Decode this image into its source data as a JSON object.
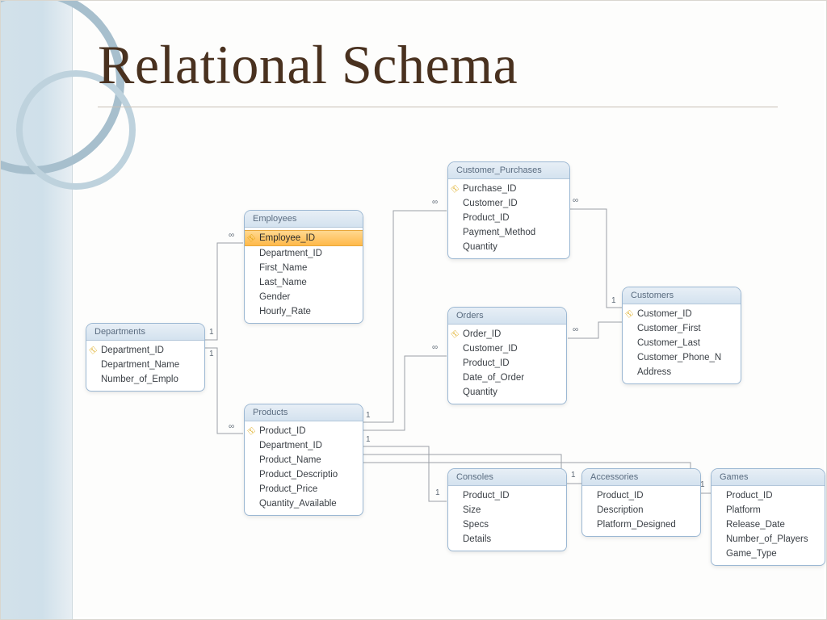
{
  "title": "Relational Schema",
  "tables": {
    "departments": {
      "name": "Departments",
      "fields": [
        {
          "label": "Department_ID",
          "pk": true
        },
        {
          "label": "Department_Name",
          "pk": false
        },
        {
          "label": "Number_of_Emplo",
          "pk": false
        }
      ]
    },
    "employees": {
      "name": "Employees",
      "fields": [
        {
          "label": "Employee_ID",
          "pk": true,
          "selected": true
        },
        {
          "label": "Department_ID",
          "pk": false
        },
        {
          "label": "First_Name",
          "pk": false
        },
        {
          "label": "Last_Name",
          "pk": false
        },
        {
          "label": "Gender",
          "pk": false
        },
        {
          "label": "Hourly_Rate",
          "pk": false
        }
      ]
    },
    "products": {
      "name": "Products",
      "fields": [
        {
          "label": "Product_ID",
          "pk": true
        },
        {
          "label": "Department_ID",
          "pk": false
        },
        {
          "label": "Product_Name",
          "pk": false
        },
        {
          "label": "Product_Descriptio",
          "pk": false
        },
        {
          "label": "Product_Price",
          "pk": false
        },
        {
          "label": "Quantity_Available",
          "pk": false
        }
      ]
    },
    "customer_purchases": {
      "name": "Customer_Purchases",
      "fields": [
        {
          "label": "Purchase_ID",
          "pk": true
        },
        {
          "label": "Customer_ID",
          "pk": false
        },
        {
          "label": "Product_ID",
          "pk": false
        },
        {
          "label": "Payment_Method",
          "pk": false
        },
        {
          "label": "Quantity",
          "pk": false
        }
      ]
    },
    "orders": {
      "name": "Orders",
      "fields": [
        {
          "label": "Order_ID",
          "pk": true
        },
        {
          "label": "Customer_ID",
          "pk": false
        },
        {
          "label": "Product_ID",
          "pk": false
        },
        {
          "label": "Date_of_Order",
          "pk": false
        },
        {
          "label": "Quantity",
          "pk": false
        }
      ]
    },
    "customers": {
      "name": "Customers",
      "fields": [
        {
          "label": "Customer_ID",
          "pk": true
        },
        {
          "label": "Customer_First",
          "pk": false
        },
        {
          "label": "Customer_Last",
          "pk": false
        },
        {
          "label": "Customer_Phone_N",
          "pk": false
        },
        {
          "label": "Address",
          "pk": false
        }
      ]
    },
    "consoles": {
      "name": "Consoles",
      "fields": [
        {
          "label": "Product_ID",
          "pk": false
        },
        {
          "label": "Size",
          "pk": false
        },
        {
          "label": "Specs",
          "pk": false
        },
        {
          "label": "Details",
          "pk": false
        }
      ]
    },
    "accessories": {
      "name": "Accessories",
      "fields": [
        {
          "label": "Product_ID",
          "pk": false
        },
        {
          "label": "Description",
          "pk": false
        },
        {
          "label": "Platform_Designed",
          "pk": false
        }
      ]
    },
    "games": {
      "name": "Games",
      "fields": [
        {
          "label": "Product_ID",
          "pk": false
        },
        {
          "label": "Platform",
          "pk": false
        },
        {
          "label": "Release_Date",
          "pk": false
        },
        {
          "label": "Number_of_Players",
          "pk": false
        },
        {
          "label": "Game_Type",
          "pk": false
        }
      ]
    }
  },
  "relationships": [
    {
      "from": "departments",
      "to": "employees",
      "from_card": "1",
      "to_card": "∞"
    },
    {
      "from": "departments",
      "to": "products",
      "from_card": "1",
      "to_card": "∞"
    },
    {
      "from": "products",
      "to": "customer_purchases",
      "from_card": "1",
      "to_card": "∞"
    },
    {
      "from": "products",
      "to": "orders",
      "from_card": "1",
      "to_card": "∞"
    },
    {
      "from": "products",
      "to": "consoles",
      "from_card": "1",
      "to_card": "1"
    },
    {
      "from": "products",
      "to": "accessories",
      "from_card": "1",
      "to_card": "1"
    },
    {
      "from": "products",
      "to": "games",
      "from_card": "1",
      "to_card": "1"
    },
    {
      "from": "customers",
      "to": "customer_purchases",
      "from_card": "1",
      "to_card": "∞"
    },
    {
      "from": "customers",
      "to": "orders",
      "from_card": "1",
      "to_card": "∞"
    }
  ],
  "labels": {
    "one": "1",
    "many": "∞"
  }
}
